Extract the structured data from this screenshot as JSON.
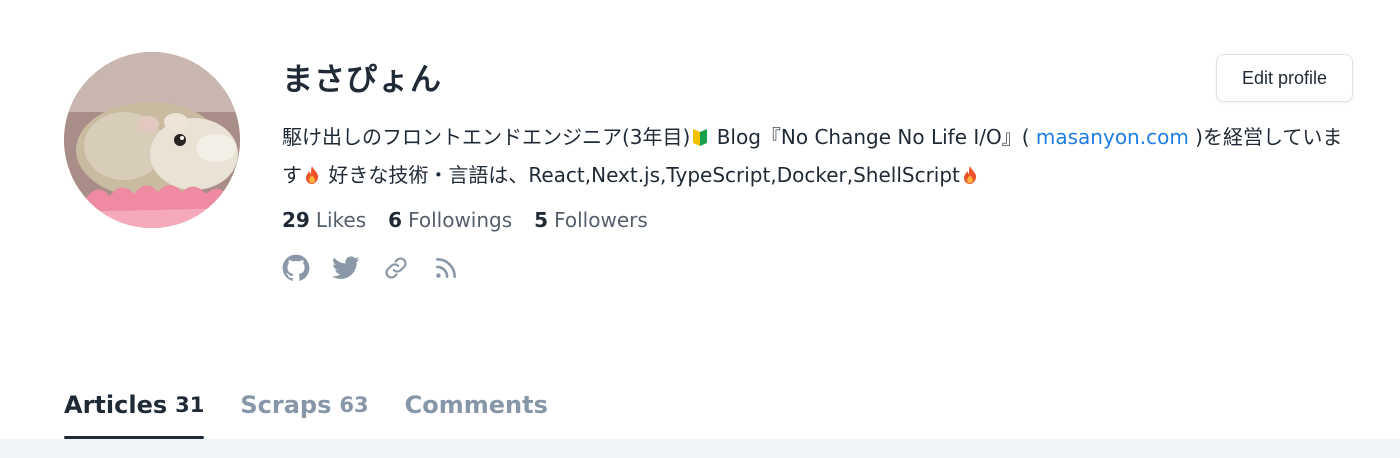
{
  "profile": {
    "name": "まさぴょん",
    "bio": {
      "part1": "駆け出しのフロントエンドエンジニア(3年目)",
      "part2": " Blog『No Change No Life I/O』( ",
      "link": "masanyon.com",
      "part3": " )を経営しています",
      "part4": " 好きな技術・言語は、React,Next.js,TypeScript,Docker,ShellScript"
    },
    "stats": [
      {
        "count": "29",
        "label": "Likes"
      },
      {
        "count": "6",
        "label": "Followings"
      },
      {
        "count": "5",
        "label": "Followers"
      }
    ],
    "links": [
      "github-icon",
      "twitter-icon",
      "link-icon",
      "rss-icon"
    ]
  },
  "actions": {
    "edit_profile_label": "Edit profile"
  },
  "tabs": [
    {
      "label": "Articles",
      "count": "31",
      "active": true
    },
    {
      "label": "Scraps",
      "count": "63",
      "active": false
    },
    {
      "label": "Comments",
      "count": "",
      "active": false
    }
  ],
  "colors": {
    "text": "#1f2a36",
    "muted": "#56606c",
    "tab_inactive": "#8796a8",
    "link": "#1f7ee6",
    "beginner_badge_green": "#19a04a",
    "beginner_badge_yellow": "#f2c200",
    "fire": "#f0512b",
    "background_band": "#f1f5f9"
  }
}
